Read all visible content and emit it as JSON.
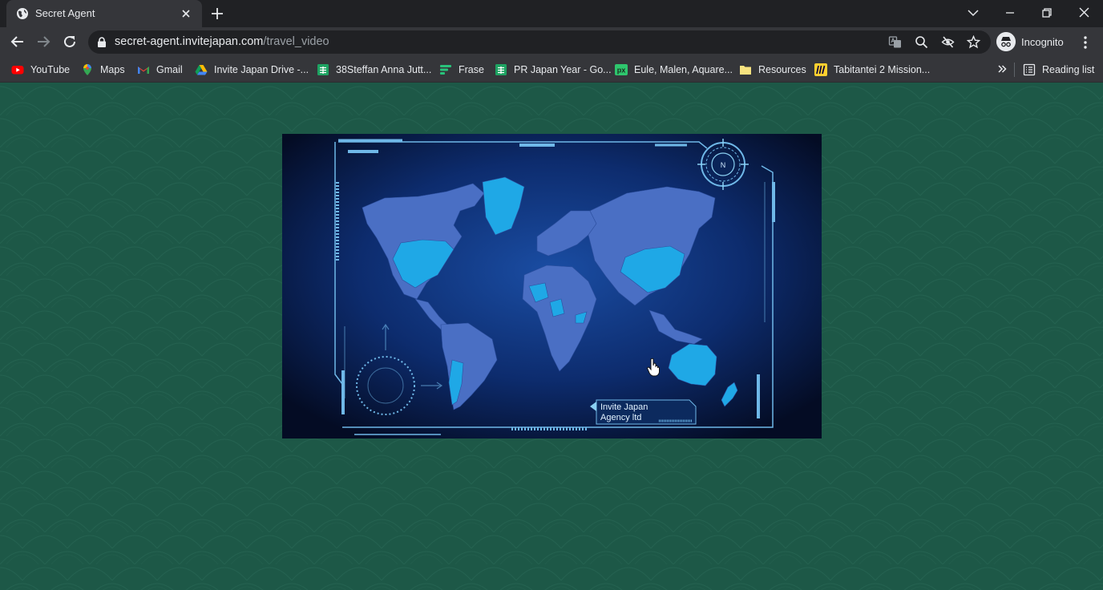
{
  "browser": {
    "tab": {
      "title": "Secret Agent"
    },
    "address_bar": {
      "host": "secret-agent.invitejapan.com",
      "path": "/travel_video"
    },
    "profile": {
      "label": "Incognito"
    },
    "bookmarks": [
      {
        "label": "YouTube",
        "icon": "youtube-icon"
      },
      {
        "label": "Maps",
        "icon": "maps-icon"
      },
      {
        "label": "Gmail",
        "icon": "gmail-icon"
      },
      {
        "label": "Invite Japan Drive -...",
        "icon": "drive-icon"
      },
      {
        "label": "38Steffan Anna Jutt...",
        "icon": "sheets-icon"
      },
      {
        "label": "Frase",
        "icon": "frase-icon"
      },
      {
        "label": "PR Japan Year - Go...",
        "icon": "sheets-icon"
      },
      {
        "label": "Eule, Malen, Aquare...",
        "icon": "pixabay-icon"
      },
      {
        "label": "Resources",
        "icon": "folder-icon"
      },
      {
        "label": "Tabitantei 2 Mission...",
        "icon": "miro-icon"
      }
    ],
    "reading_list": {
      "label": "Reading list"
    }
  },
  "video": {
    "overlay_label": [
      "Invite Japan",
      "Agency ltd"
    ],
    "compass_letter": "N"
  },
  "colors": {
    "page_background": "#1d5847",
    "chrome_dark": "#202124",
    "chrome_toolbar": "#35363a",
    "map_land": "#4a6fc4",
    "map_highlight": "#1fa8e6",
    "hud_line": "#6fb8e8"
  }
}
